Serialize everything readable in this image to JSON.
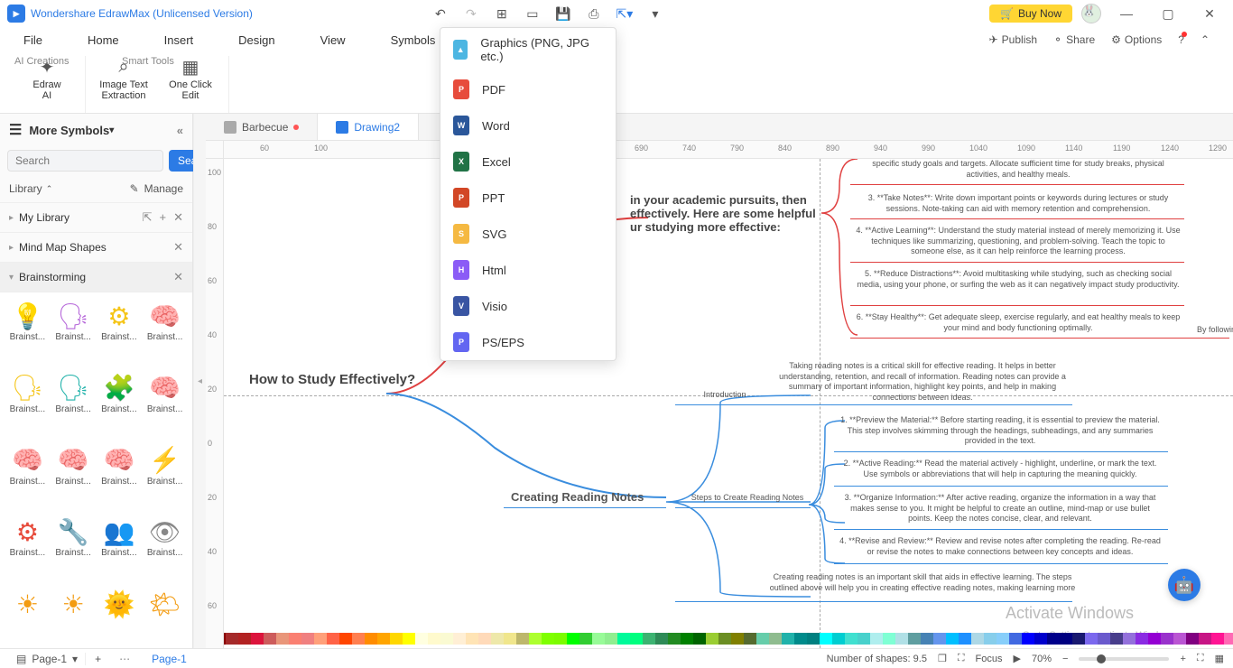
{
  "titlebar": {
    "app_title": "Wondershare EdrawMax (Unlicensed Version)",
    "buy_now": "Buy Now"
  },
  "menubar": {
    "items": [
      "File",
      "Home",
      "Insert",
      "Design",
      "View",
      "Symbols"
    ],
    "right": {
      "publish": "Publish",
      "share": "Share",
      "options": "Options"
    }
  },
  "ribbon": {
    "edraw_ai": "Edraw\nAI",
    "image_text": "Image Text\nExtraction",
    "one_click": "One Click\nEdit",
    "group1": "AI Creations",
    "group2": "Smart Tools"
  },
  "sidebar": {
    "more_symbols": "More Symbols",
    "search_placeholder": "Search",
    "search_btn": "Search",
    "library": "Library",
    "manage": "Manage",
    "my_library": "My Library",
    "mind_map": "Mind Map Shapes",
    "brainstorming": "Brainstorming",
    "shape_label": "Brainst..."
  },
  "doctabs": {
    "tab1": "Barbecue",
    "tab2": "Drawing2"
  },
  "export_menu": {
    "graphics": "Graphics (PNG, JPG etc.)",
    "pdf": "PDF",
    "word": "Word",
    "excel": "Excel",
    "ppt": "PPT",
    "svg": "SVG",
    "html": "Html",
    "visio": "Visio",
    "ps": "PS/EPS"
  },
  "mindmap": {
    "title": "How to Study Effectively?",
    "desc": "in your academic pursuits, then\neffectively. Here are some helpful\nur studying more effective:",
    "sub1": "Creating Reading Notes",
    "sub1_desc": "Steps to Create Reading Notes",
    "sub1_intro_label": "Introduction",
    "intro_text": "Taking reading notes is a critical skill for effective reading. It helps in better understanding, retention, and recall of information. Reading notes can provide a summary of important information, highlight key points, and help in making connections between ideas.",
    "red_items": [
      "specific study goals and targets. Allocate sufficient time for study breaks, physical activities, and healthy meals.",
      "3. **Take Notes**: Write down important points or keywords during lectures or study sessions. Note-taking can aid with memory retention and comprehension.",
      "4. **Active Learning**: Understand the study material instead of merely memorizing it. Use techniques like summarizing, questioning, and problem-solving. Teach the topic to someone else, as it can help reinforce the learning process.",
      "5. **Reduce Distractions**: Avoid multitasking while studying, such as checking social media, using your phone, or surfing the web as it can negatively impact study productivity.",
      "6. **Stay Healthy**: Get adequate sleep, exercise regularly, and eat healthy meals to keep your mind and body functioning optimally."
    ],
    "red_tail": "By followin",
    "blue_items": [
      "1. **Preview the Material:** Before starting reading, it is essential to preview the material. This step involves skimming through the headings, subheadings, and any summaries provided in the text.",
      "2. **Active Reading:** Read the material actively - highlight, underline, or mark the text. Use symbols or abbreviations that will help in capturing the meaning quickly.",
      "3. **Organize Information:** After active reading, organize the information in a way that makes sense to you. It might be helpful to create an outline, mind-map or use bullet points. Keep the notes concise, clear, and relevant.",
      "4. **Revise and Review:** Review and revise notes after completing the reading. Re-read or revise the notes to make connections between key concepts and ideas."
    ],
    "conclusion": "Creating reading notes is an important skill that aids in effective learning. The steps outlined above will help you in creating effective reading notes, making learning more"
  },
  "statusbar": {
    "page_sel": "Page-1",
    "page_tab": "Page-1",
    "shape_count": "Number of shapes: 9.5",
    "focus": "Focus",
    "zoom": "70%"
  },
  "watermark": "Activate Windows",
  "watermark2": "Go to Settings to activate Windows.",
  "palette": [
    "#8B0000",
    "#A52A2A",
    "#B22222",
    "#DC143C",
    "#CD5C5C",
    "#E9967A",
    "#FA8072",
    "#F08080",
    "#FFA07A",
    "#FF6347",
    "#FF4500",
    "#FF7F50",
    "#FF8C00",
    "#FFA500",
    "#FFD700",
    "#FFFF00",
    "#FFFFE0",
    "#FFFACD",
    "#FAFAD2",
    "#FFEFD5",
    "#FFE4B5",
    "#FFDAB9",
    "#EEE8AA",
    "#F0E68C",
    "#BDB76B",
    "#ADFF2F",
    "#7FFF00",
    "#7CFC00",
    "#00FF00",
    "#32CD32",
    "#98FB98",
    "#90EE90",
    "#00FA9A",
    "#00FF7F",
    "#3CB371",
    "#2E8B57",
    "#228B22",
    "#008000",
    "#006400",
    "#9ACD32",
    "#6B8E23",
    "#808000",
    "#556B2F",
    "#66CDAA",
    "#8FBC8F",
    "#20B2AA",
    "#008B8B",
    "#008080",
    "#00FFFF",
    "#00CED1",
    "#40E0D0",
    "#48D1CC",
    "#AFEEEE",
    "#7FFFD4",
    "#B0E0E6",
    "#5F9EA0",
    "#4682B4",
    "#6495ED",
    "#00BFFF",
    "#1E90FF",
    "#ADD8E6",
    "#87CEEB",
    "#87CEFA",
    "#4169E1",
    "#0000FF",
    "#0000CD",
    "#00008B",
    "#000080",
    "#191970",
    "#7B68EE",
    "#6A5ACD",
    "#483D8B",
    "#9370DB",
    "#8A2BE2",
    "#9400D3",
    "#9932CC",
    "#BA55D3",
    "#800080",
    "#C71585",
    "#FF1493",
    "#FF69B4"
  ]
}
